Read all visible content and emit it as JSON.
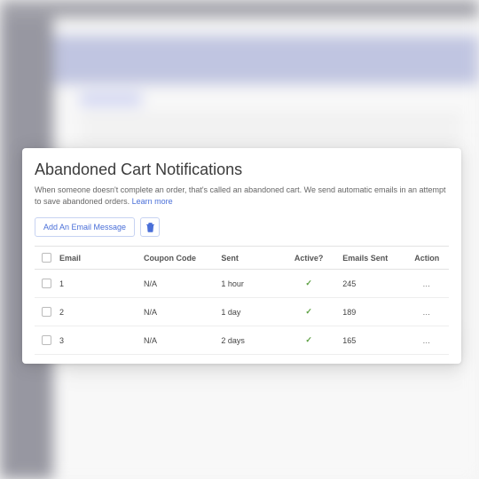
{
  "panel": {
    "title": "Abandoned Cart Notifications",
    "description": "When someone doesn't complete an order, that's called an abandoned cart. We send automatic emails in an attempt to save abandoned orders.",
    "learn_more_label": "Learn more"
  },
  "toolbar": {
    "add_email_label": "Add An Email Message",
    "delete_icon": "trash-icon"
  },
  "table": {
    "headers": {
      "email": "Email",
      "coupon": "Coupon Code",
      "sent": "Sent",
      "active": "Active?",
      "emails_sent": "Emails Sent",
      "action": "Action"
    },
    "rows": [
      {
        "email": "1",
        "coupon": "N/A",
        "sent": "1 hour",
        "active": true,
        "emails_sent": "245"
      },
      {
        "email": "2",
        "coupon": "N/A",
        "sent": "1 day",
        "active": true,
        "emails_sent": "189"
      },
      {
        "email": "3",
        "coupon": "N/A",
        "sent": "2 days",
        "active": true,
        "emails_sent": "165"
      }
    ],
    "action_symbol": "…"
  },
  "icons": {
    "check": "✓"
  }
}
